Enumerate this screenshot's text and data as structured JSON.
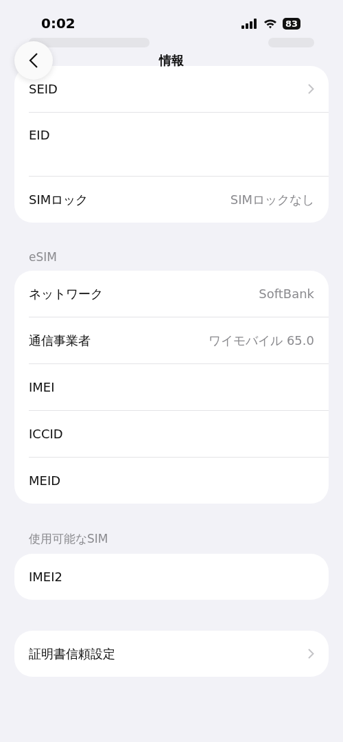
{
  "status_bar": {
    "time": "0:02",
    "battery": "83"
  },
  "nav": {
    "title": "情報"
  },
  "sections": [
    {
      "rows": [
        {
          "label": "SEID",
          "value": null,
          "chevron": true,
          "tall": false
        },
        {
          "label": "EID",
          "value": null,
          "chevron": false,
          "tall": true
        },
        {
          "label": "SIMロック",
          "value": "SIMロックなし",
          "chevron": false,
          "tall": false
        }
      ]
    },
    {
      "header": "eSIM",
      "rows": [
        {
          "label": "ネットワーク",
          "value": "SoftBank",
          "chevron": false,
          "tall": false
        },
        {
          "label": "通信事業者",
          "value": "ワイモバイル 65.0",
          "chevron": false,
          "tall": false
        },
        {
          "label": "IMEI",
          "value": null,
          "chevron": false,
          "tall": false
        },
        {
          "label": "ICCID",
          "value": null,
          "chevron": false,
          "tall": false
        },
        {
          "label": "MEID",
          "value": null,
          "chevron": false,
          "tall": false
        }
      ]
    },
    {
      "header": "使用可能なSIM",
      "rows": [
        {
          "label": "IMEI2",
          "value": null,
          "chevron": false,
          "tall": false
        }
      ]
    },
    {
      "rows": [
        {
          "label": "証明書信頼設定",
          "value": null,
          "chevron": true,
          "tall": false
        }
      ]
    }
  ]
}
